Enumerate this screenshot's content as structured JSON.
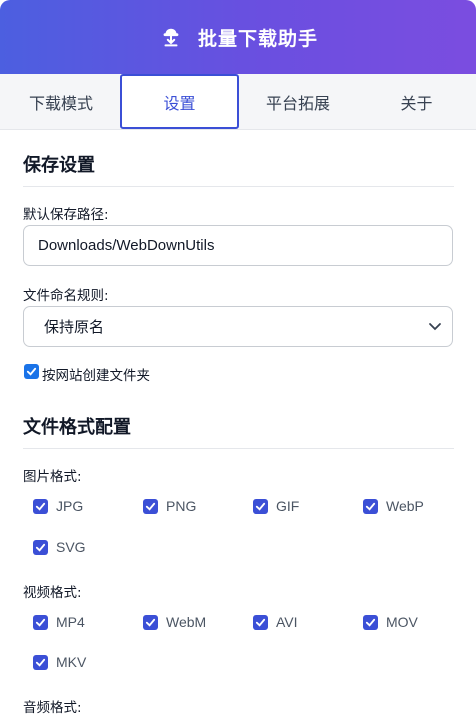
{
  "header": {
    "title": "批量下载助手",
    "logo_icon": "download-cloud-icon"
  },
  "tabs": [
    {
      "label": "下载模式",
      "active": false
    },
    {
      "label": "设置",
      "active": true
    },
    {
      "label": "平台拓展",
      "active": false
    },
    {
      "label": "关于",
      "active": false
    }
  ],
  "save_settings": {
    "title": "保存设置",
    "path_label": "默认保存路径:",
    "path_value": "Downloads/WebDownUtils",
    "naming_label": "文件命名规则:",
    "naming_value": "保持原名",
    "folder_checkbox_label": "按网站创建文件夹",
    "folder_checked": true
  },
  "format_config": {
    "title": "文件格式配置",
    "image_label": "图片格式:",
    "image_formats": [
      "JPG",
      "PNG",
      "GIF",
      "WebP",
      "SVG"
    ],
    "video_label": "视频格式:",
    "video_formats": [
      "MP4",
      "WebM",
      "AVI",
      "MOV",
      "MKV"
    ],
    "audio_label": "音频格式:"
  },
  "colors": {
    "accent": "#3b4fd6",
    "header_start": "#4c5fe0",
    "header_end": "#7b4de0"
  }
}
